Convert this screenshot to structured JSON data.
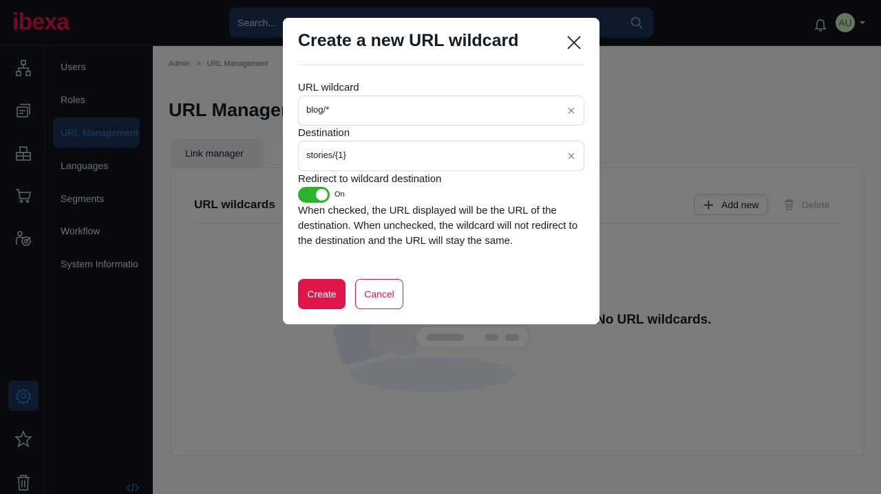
{
  "header": {
    "logo_text": "ibexa",
    "search_placeholder": "Search...",
    "avatar_initials": "AU"
  },
  "rail": {
    "items": [
      "structure-icon",
      "content-icon",
      "products-icon",
      "commerce-icon",
      "marketing-icon",
      "settings-icon",
      "bookmarks-icon",
      "trash-icon"
    ],
    "active": "settings-icon"
  },
  "subnav": {
    "items": [
      {
        "label": "Users"
      },
      {
        "label": "Roles"
      },
      {
        "label": "URL Management"
      },
      {
        "label": "Languages"
      },
      {
        "label": "Segments"
      },
      {
        "label": "Workflow"
      },
      {
        "label": "System Informatio"
      }
    ],
    "active_index": 2
  },
  "main": {
    "breadcrumb": {
      "root": "Admin",
      "separator": ">",
      "current": "URL Management"
    },
    "title": "URL Manager",
    "tabs": [
      {
        "label": "Link manager"
      }
    ],
    "panel": {
      "title": "URL wildcards",
      "add_label": "Add new",
      "delete_label": "Delete",
      "empty_text": "No URL wildcards."
    }
  },
  "modal": {
    "title": "Create a new URL wildcard",
    "url_wildcard_label": "URL wildcard",
    "url_wildcard_value": "blog/*",
    "destination_label": "Destination",
    "destination_value": "stories/{1}",
    "redirect_label": "Redirect to wildcard destination",
    "redirect_state": "On",
    "redirect_enabled": true,
    "help_text": "When checked, the URL displayed will be the URL of the destination. When unchecked, the wildcard will not redirect to the destination and the URL will stay the same.",
    "create_label": "Create",
    "cancel_label": "Cancel"
  },
  "colors": {
    "brand": "#e0154a",
    "nav_bg": "#10141d",
    "active_bg": "#1c3458",
    "toggle_on": "#2db22d"
  }
}
